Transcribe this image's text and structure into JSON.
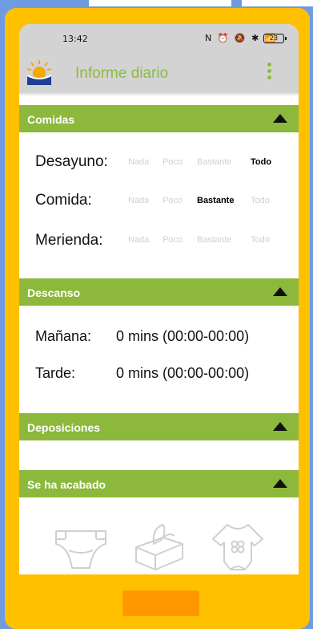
{
  "status_bar": {
    "time": "13:42",
    "icons_text": "N ⏰ 🔕 ✱ 📶",
    "battery": "23"
  },
  "app_bar": {
    "title": "Informe diario",
    "logo_icon": "sunrise-logo-icon",
    "menu_icon": "more-vert-icon"
  },
  "sections": {
    "comidas": {
      "title": "Comidas"
    },
    "descanso": {
      "title": "Descanso"
    },
    "deposiciones": {
      "title": "Deposiciones"
    },
    "se_ha_acabado": {
      "title": "Se ha acabado"
    }
  },
  "meals": [
    {
      "label": "Desayuno:",
      "options": [
        "Nada",
        "Poco",
        "Bastante",
        "Todo"
      ],
      "selected": "Todo"
    },
    {
      "label": "Comida:",
      "options": [
        "Nada",
        "Poco",
        "Bastante",
        "Todo"
      ],
      "selected": "Bastante"
    },
    {
      "label": "Merienda:",
      "options": [
        "Nada",
        "Poco",
        "Bastante",
        "Todo"
      ],
      "selected": ""
    }
  ],
  "rest": [
    {
      "label": "Mañana:",
      "value": "0 mins (00:00-00:00)"
    },
    {
      "label": "Tarde:",
      "value": "0 mins (00:00-00:00)"
    }
  ],
  "supplies_icons": [
    "diaper-icon",
    "wipes-icon",
    "bodysuit-icon"
  ],
  "colors": {
    "accent_green": "#8cb83c",
    "frame_yellow": "#ffc000",
    "button_orange": "#ff9800",
    "background_blue": "#6f9be0",
    "appbar_gray": "#d3d3d3"
  }
}
